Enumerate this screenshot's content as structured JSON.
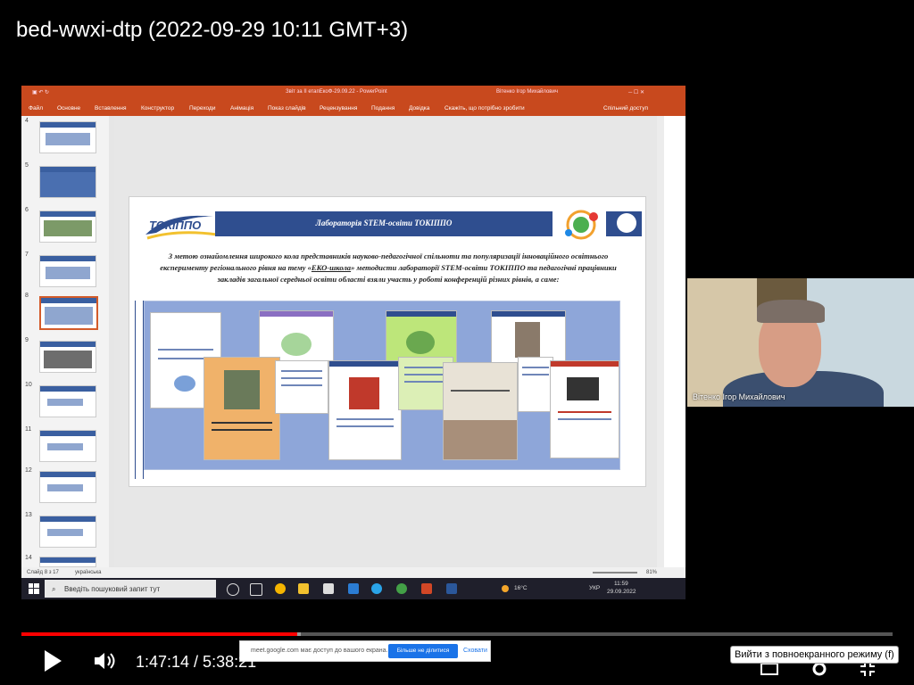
{
  "video": {
    "title": "bed-wwxi-dtp (2022-09-29 10:11 GMT+3)",
    "time_display": "1:47:14 / 5:38:21",
    "progress": 0.317,
    "fullscreen_tooltip": "Вийти з повноекранного режиму (f)"
  },
  "powerpoint": {
    "window_title": "Звіт за II етапЕкоФ-29.09.22 - PowerPoint",
    "user_name": "Вітенко Ігор Михайлович",
    "ribbon_tabs": [
      "Файл",
      "Основне",
      "Вставлення",
      "Конструктор",
      "Переходи",
      "Анімація",
      "Показ слайдів",
      "Рецензування",
      "Подання",
      "Довідка"
    ],
    "tell_me": "Скажіть, що потрібно зробити",
    "share": "Спільний доступ",
    "thumb_numbers": [
      "4",
      "5",
      "6",
      "7",
      "8",
      "9",
      "10",
      "11",
      "12",
      "13",
      "14"
    ],
    "selected_thumb": "8",
    "status_slide": "Слайд 8 з 17",
    "status_lang": "українська",
    "zoom": "81%"
  },
  "slide": {
    "logo_text": "ТОКІППО",
    "header": "Лабораторія STEM-освіти ТОКІППО",
    "body_part1": "З метою ознайомлення широкого кола представників науково-педагогічної спільноти та популяризації інноваційного освітнього експерименту регіонального рівня на тему «",
    "body_underline": "ЕКО-школа",
    "body_part2": "» методисти лабораторії STEM-освіти ТОКІППО та педагогічні працівники закладів загальної середньої освіти області взяли участь у роботі конференцій різних рівнів, а саме:"
  },
  "share_notice": {
    "text": "meet.google.com має доступ до вашого екрана.",
    "stop_button": "Більше не ділитися",
    "hide_button": "Сховати"
  },
  "taskbar": {
    "search_placeholder": "Введіть пошуковий запит тут",
    "temperature": "16°C",
    "lang": "УКР",
    "time": "11:59",
    "date": "29.09.2022"
  },
  "webcam": {
    "participant_name": "Вітенко Ігор Михайлович"
  },
  "colors": {
    "ppt_accent": "#c8491e",
    "slide_band": "#2f4e8f",
    "progress_played": "#ff0000",
    "share_button": "#1a73e8"
  }
}
